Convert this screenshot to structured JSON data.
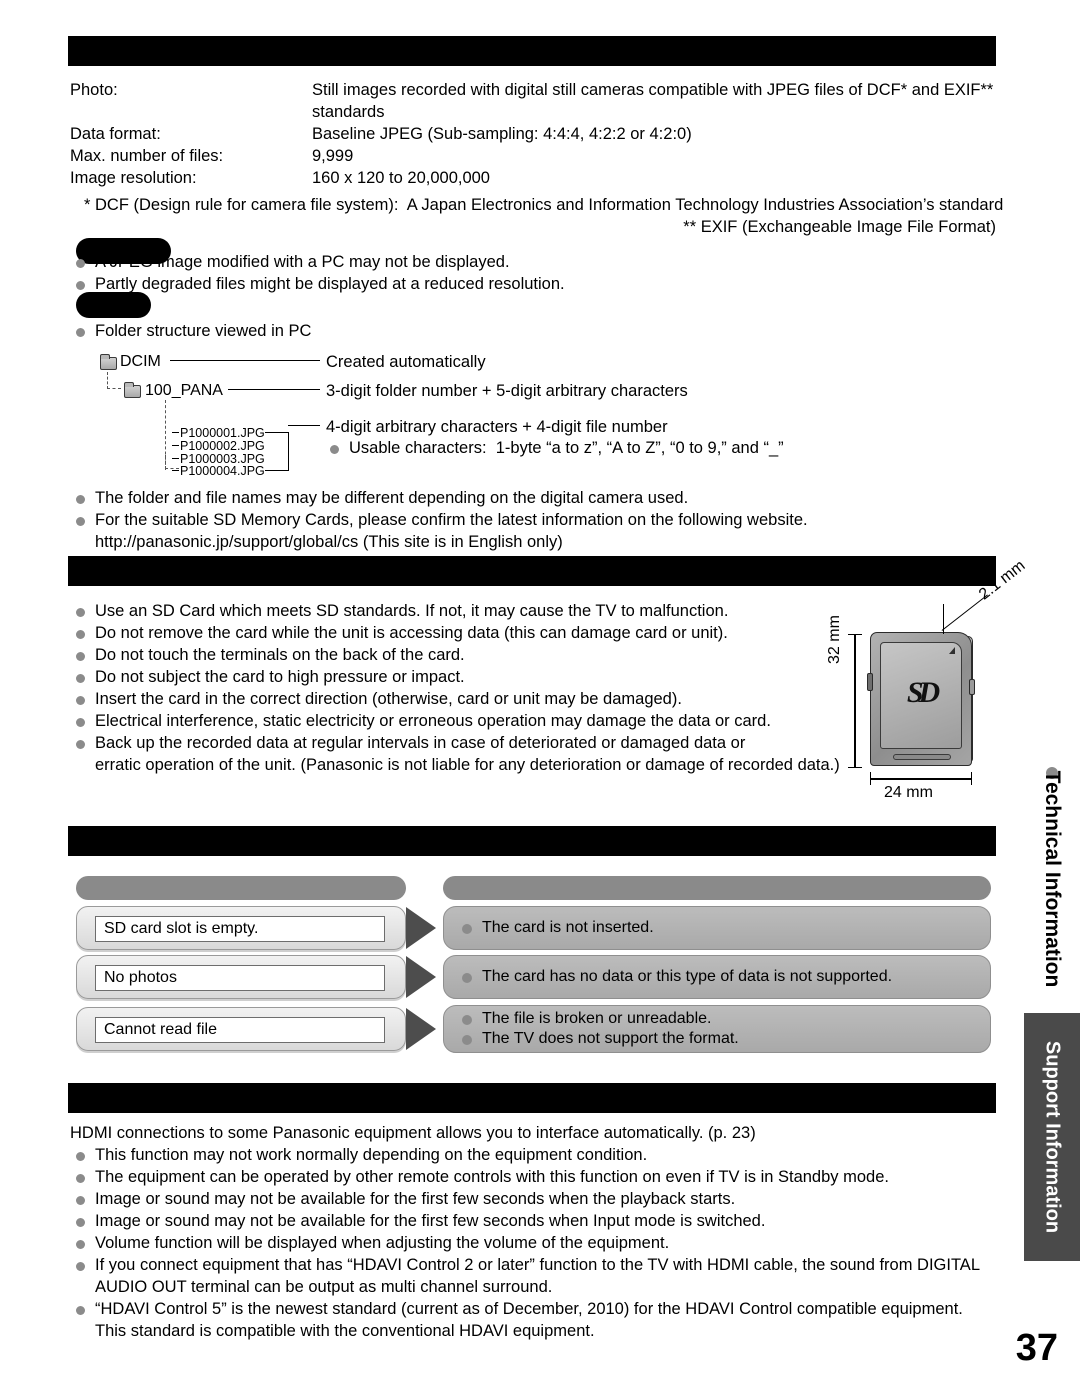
{
  "page": {
    "number": "37"
  },
  "section_photo": {
    "header_bar": "",
    "rows": [
      {
        "label": "Photo:",
        "value": "Still images recorded with digital still cameras compatible with JPEG files of DCF* and EXIF**",
        "value2": "standards"
      },
      {
        "label": "Data format:",
        "value": "Baseline JPEG (Sub-sampling: 4:4:4, 4:2:2 or 4:2:0)"
      },
      {
        "label": "Max. number of files:",
        "value": "9,999"
      },
      {
        "label": "Image resolution:",
        "value": "160 x 120 to 20,000,000"
      }
    ],
    "footnote1": "* DCF (Design rule for camera file system):  A Japan Electronics and Information Technology Industries Association’s standard",
    "footnote2": "** EXIF (Exchangeable Image File Format)"
  },
  "section_note": {
    "pill_label": "",
    "bullets": [
      "A JPEG image modified with a PC may not be displayed.",
      "Partly degraded files might be displayed at a reduced resolution."
    ]
  },
  "section_folder": {
    "pill_label": "",
    "intro_bullet": "Folder structure viewed in PC",
    "tree": {
      "root": "DCIM",
      "root_note": "Created automatically",
      "child": "100_PANA",
      "child_note": "3-digit folder number + 5-digit arbitrary characters",
      "files": [
        "P1000001.JPG",
        "P1000002.JPG",
        "P1000003.JPG",
        "P1000004.JPG"
      ],
      "files_note": "4-digit arbitrary characters + 4-digit file number",
      "files_sub_bullet": "Usable characters:  1-byte “a to z”, “A to Z”, “0 to 9,” and “_”"
    },
    "bullets_after": [
      "The folder and file names may be different depending on the digital camera used.",
      "For the suitable SD Memory Cards, please confirm the latest information on the following website."
    ],
    "website": "http://panasonic.jp/support/global/cs (This site is in English only)"
  },
  "section_card_caution": {
    "header_bar": "",
    "bullets": [
      "Use an SD Card which meets SD standards. If not, it may cause the TV to malfunction.",
      "Do not remove the card while the unit is accessing data (this can damage card or unit).",
      "Do not touch the terminals on the back of the card.",
      "Do not subject the card to high pressure or impact.",
      "Insert the card in the correct direction (otherwise, card or unit may be damaged).",
      "Electrical interference, static electricity or erroneous operation may damage the data or card.",
      "Back up the recorded data at regular intervals in case of deteriorated or damaged data or",
      "erratic operation of the unit. (Panasonic is not liable for any deterioration or damage of recorded data.)"
    ],
    "sd_card_diagram": {
      "logo": "SD",
      "thickness": "2.1 mm",
      "height": "32 mm",
      "width": "24 mm"
    }
  },
  "section_messages": {
    "header_bar": "",
    "col_head_left": "",
    "col_head_right": "",
    "rows": [
      {
        "message": "SD card slot is empty.",
        "causes": [
          "The card is not inserted."
        ]
      },
      {
        "message": "No photos",
        "causes": [
          "The card has no data or this type of data is not supported."
        ]
      },
      {
        "message": "Cannot read file",
        "causes": [
          "The file is broken or unreadable.",
          "The TV does not support the format."
        ]
      }
    ]
  },
  "section_hdmi": {
    "header_bar": "",
    "intro": "HDMI connections to some Panasonic equipment allows you to interface automatically. (p. 23)",
    "bullets": [
      "This function may not work normally depending on the equipment condition.",
      "The equipment can be operated by other remote controls with this function on even if TV is in Standby mode.",
      "Image or sound may not be available for the first few seconds when the playback starts.",
      "Image or sound may not be available for the first few seconds when Input mode is switched.",
      "Volume function will be displayed when adjusting the volume of the equipment.",
      "If you connect equipment that has “HDAVI Control 2 or later” function to the TV with HDMI cable, the sound from DIGITAL",
      "AUDIO OUT terminal can be output as multi channel surround.",
      "“HDAVI Control 5” is the newest standard (current as of December, 2010) for the HDAVI Control compatible equipment.",
      "This standard is compatible with the conventional HDAVI equipment."
    ]
  },
  "side_tabs": {
    "technical": "Technical Information",
    "support": "Support Information"
  }
}
